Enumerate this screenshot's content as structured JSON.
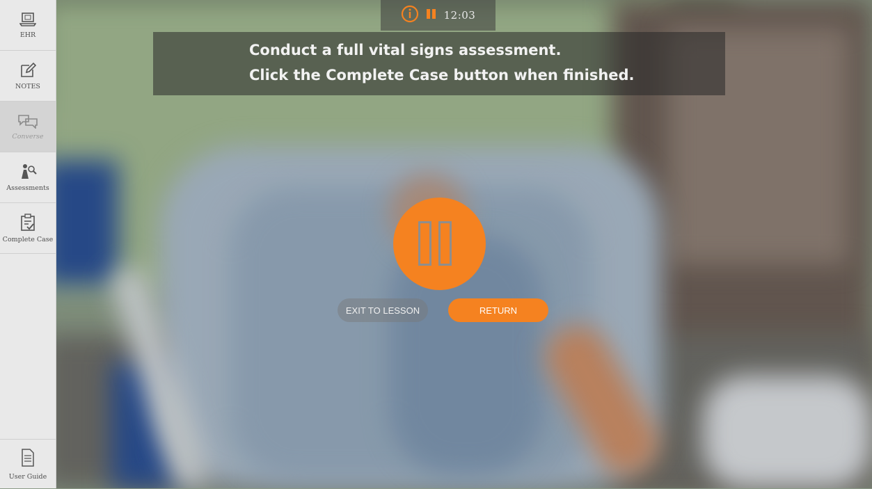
{
  "sidebar": {
    "items": [
      {
        "label": "EHR",
        "icon": "laptop-icon",
        "enabled": true
      },
      {
        "label": "NOTES",
        "icon": "notepad-pencil-icon",
        "enabled": true
      },
      {
        "label": "Converse",
        "icon": "speech-bubbles-icon",
        "enabled": false
      },
      {
        "label": "Assessments",
        "icon": "person-search-icon",
        "enabled": true
      },
      {
        "label": "Complete Case",
        "icon": "clipboard-check-icon",
        "enabled": true
      }
    ],
    "user_guide": {
      "label": "User Guide",
      "icon": "document-icon"
    }
  },
  "status": {
    "info_icon": "info-icon",
    "pause_icon": "pause-icon",
    "timer": "12:03"
  },
  "instructions": {
    "line1": "Conduct a full vital signs assessment.",
    "line2": "Click the Complete Case button when finished."
  },
  "pause_overlay": {
    "icon": "pause-icon",
    "exit_label": "EXIT TO LESSON",
    "return_label": "RETURN"
  },
  "colors": {
    "accent": "#f58220",
    "sidebar_bg": "#e9e9e9",
    "banner_bg": "rgba(40,40,40,0.55)"
  }
}
